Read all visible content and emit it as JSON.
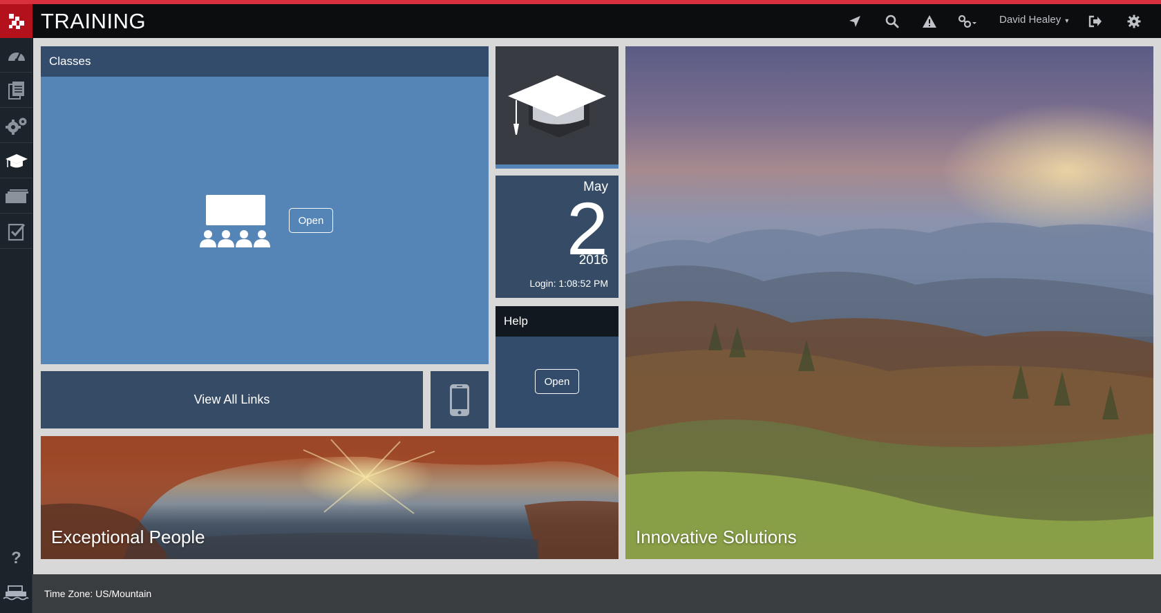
{
  "header": {
    "title": "TRAINING",
    "user_name": "David Healey",
    "icons": [
      "location-arrow-icon",
      "search-icon",
      "warning-icon",
      "links-icon",
      "logout-icon",
      "gear-icon"
    ]
  },
  "sidebar": {
    "items": [
      {
        "icon": "dashboard-icon"
      },
      {
        "icon": "documents-icon"
      },
      {
        "icon": "gears-icon"
      },
      {
        "icon": "graduation-cap-icon",
        "active": true
      },
      {
        "icon": "folders-icon"
      },
      {
        "icon": "checklist-icon"
      }
    ],
    "help_label": "?"
  },
  "tiles": {
    "classes": {
      "title": "Classes",
      "open_label": "Open"
    },
    "date": {
      "month": "May",
      "day": "2",
      "year": "2016",
      "login": "Login: 1:08:52 PM"
    },
    "help": {
      "title": "Help",
      "open_label": "Open"
    },
    "links": {
      "label": "View All Links"
    },
    "people": {
      "caption": "Exceptional People"
    },
    "solutions": {
      "caption": "Innovative Solutions"
    }
  },
  "footer": {
    "timezone": "Time Zone: US/Mountain"
  },
  "colors": {
    "accent": "#d8303c",
    "brand": "#b3121c",
    "tile_blue": "#5585b7",
    "tile_navy": "#354b66",
    "tile_header": "#334c6b"
  }
}
